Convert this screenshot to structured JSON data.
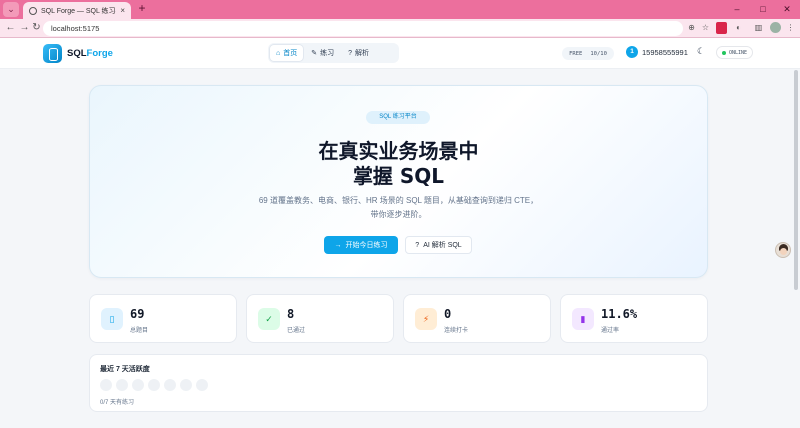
{
  "browser": {
    "tab_title": "SQL Forge — SQL 练习平台",
    "tab_close": "×",
    "new_tab": "+",
    "url": "localhost:5175",
    "controls": {
      "minimize": "–",
      "maximize": "□",
      "close": "✕"
    },
    "nav_icons": {
      "back": "←",
      "forward": "→",
      "reload": "↻"
    },
    "toolbar_icons": {
      "zoom": "⊕",
      "bookmark": "☆",
      "menu": "⋮"
    }
  },
  "header": {
    "brand_sql": "SQL",
    "brand_forge": "Forge",
    "nav": [
      {
        "icon": "⌂",
        "label": "首页",
        "active": true
      },
      {
        "icon": "✎",
        "label": "练习",
        "active": false
      },
      {
        "icon": "?",
        "label": "解析",
        "active": false
      }
    ],
    "quota_plan": "FREE",
    "quota_value": "10/10",
    "user_badge": "1",
    "user_phone": "15958555991",
    "theme_icon": "☾",
    "status": "ONLINE"
  },
  "hero": {
    "tag": "SQL 练习平台",
    "title_line1": "在真实业务场景中",
    "title_line2": "掌握 SQL",
    "desc_line1": "69 道覆盖教务、电商、银行、HR 场景的 SQL 题目，从基础查询到递归 CTE，",
    "desc_line2": "带你逐步进阶。",
    "primary_icon": "→",
    "primary_label": "开始今日练习",
    "secondary_icon": "?",
    "secondary_label": "AI 解析 SQL"
  },
  "stats": [
    {
      "value": "69",
      "label": "总题目",
      "icon": "▯",
      "color": "#0ea5e9",
      "bg": "#e0f2fe"
    },
    {
      "value": "8",
      "label": "已通过",
      "icon": "✓",
      "color": "#16a34a",
      "bg": "#dcfce7"
    },
    {
      "value": "0",
      "label": "连续打卡",
      "icon": "⚡",
      "color": "#ea580c",
      "bg": "#ffedd5"
    },
    {
      "value": "11.6%",
      "label": "通过率",
      "icon": "▮",
      "color": "#9333ea",
      "bg": "#f3e8ff"
    }
  ],
  "activity": {
    "title": "最近 7 天活跃度",
    "days": [
      0,
      0,
      0,
      0,
      0,
      0,
      0
    ],
    "status": "0/7 天有练习"
  }
}
